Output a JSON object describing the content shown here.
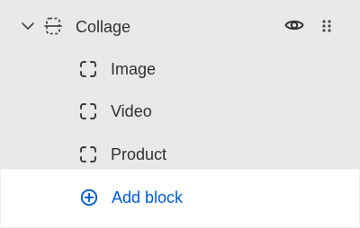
{
  "section": {
    "label": "Collage",
    "icons": {
      "expand": "chevron-down-icon",
      "section": "section-layout-icon",
      "visibility": "eye-icon",
      "drag": "drag-handle-icon"
    }
  },
  "blocks": [
    {
      "label": "Image",
      "icon": "block-dashed-square-icon"
    },
    {
      "label": "Video",
      "icon": "block-dashed-square-icon"
    },
    {
      "label": "Product",
      "icon": "block-dashed-square-icon"
    }
  ],
  "add_block": {
    "label": "Add block",
    "icon": "plus-circle-icon"
  },
  "colors": {
    "text": "#303030",
    "accent": "#005bd3",
    "panel_bg": "#e9e9e9",
    "add_bg": "#ffffff"
  }
}
